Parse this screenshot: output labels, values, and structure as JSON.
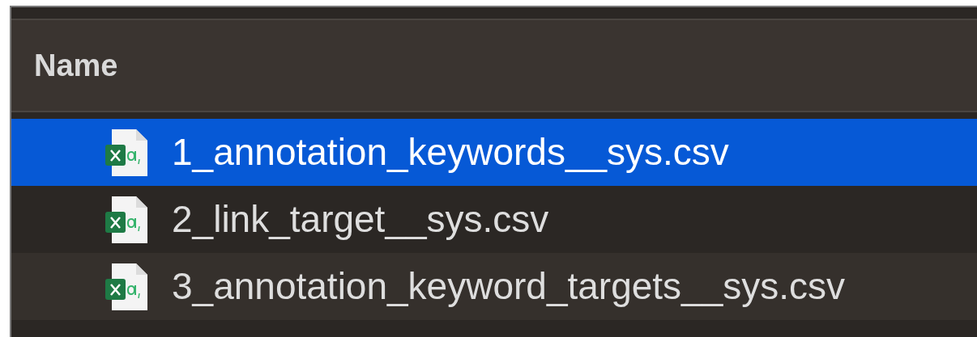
{
  "table": {
    "columns": [
      {
        "label": "Name"
      }
    ],
    "rows": [
      {
        "name": "1_annotation_keywords__sys.csv",
        "selected": true
      },
      {
        "name": "2_link_target__sys.csv",
        "selected": false
      },
      {
        "name": "3_annotation_keyword_targets__sys.csv",
        "selected": false
      }
    ]
  }
}
